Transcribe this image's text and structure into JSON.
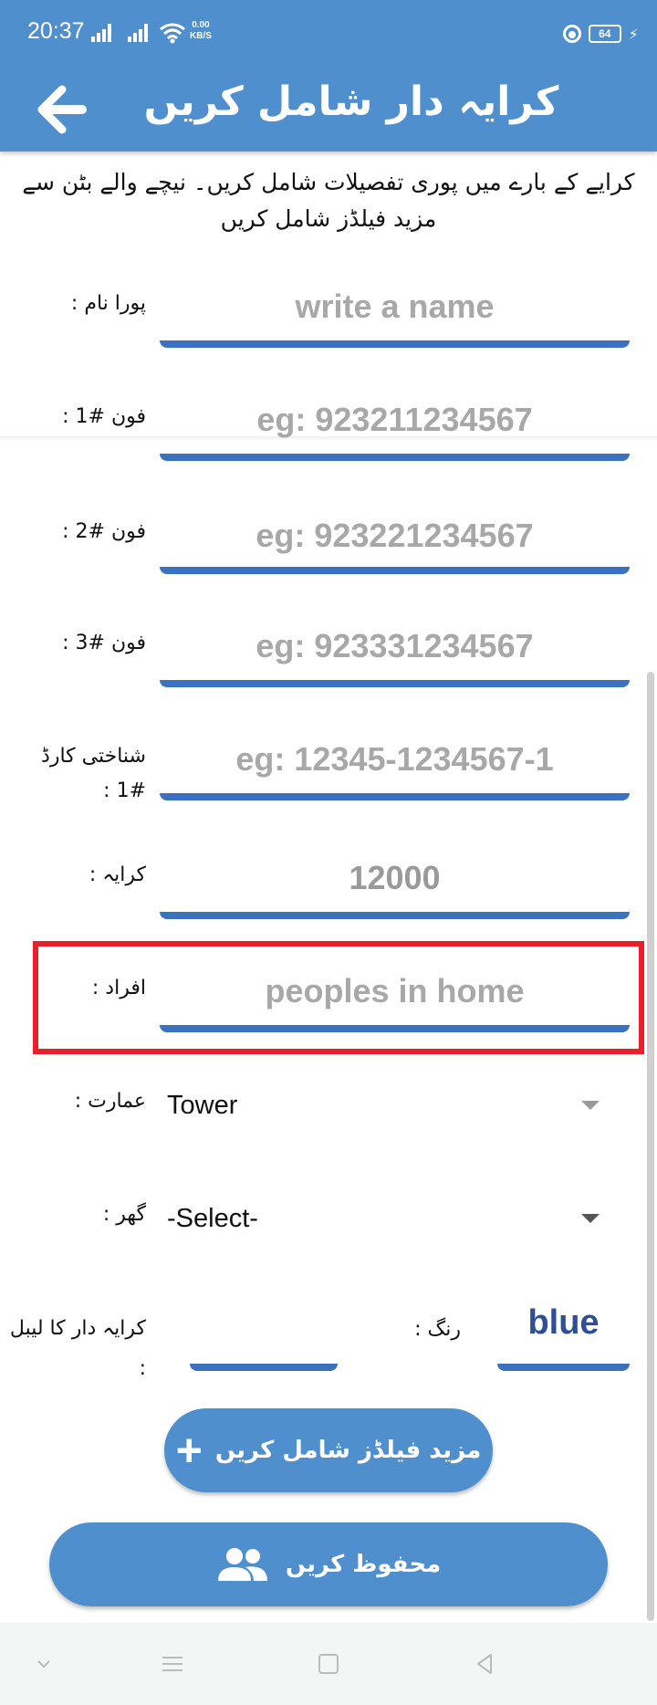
{
  "status_bar": {
    "time": "20:37",
    "net_speed_value": "0.00",
    "net_speed_unit": "KB/S",
    "battery": "64"
  },
  "app_bar": {
    "title": "کرایہ دار شامل کریں",
    "back_icon": "arrow-left-icon"
  },
  "intro_text": "کرایے کے بارے میں پوری تفصیلات شامل کریں۔ نیچے والے بٹن سے مزید فیلڈز شامل کریں",
  "fields": {
    "full_name": {
      "label": "پورا نام :",
      "placeholder": "write a name",
      "value": ""
    },
    "phone1": {
      "label": "فون #1 :",
      "placeholder": "eg: 923211234567",
      "value": ""
    },
    "phone2": {
      "label": "فون #2 :",
      "placeholder": "eg: 923221234567",
      "value": ""
    },
    "phone3": {
      "label": "فون #3 :",
      "placeholder": "eg: 923331234567",
      "value": ""
    },
    "cnic1": {
      "label": "شناختی کارڈ #1 :",
      "placeholder": "eg: 12345-1234567-1",
      "value": ""
    },
    "rent": {
      "label": "کرایہ :",
      "placeholder": "",
      "value": "12000"
    },
    "people": {
      "label": "افراد :",
      "placeholder": "peoples in home",
      "value": ""
    }
  },
  "selects": {
    "building": {
      "label": "عمارت :",
      "selected": "Tower"
    },
    "house": {
      "label": "گھر :",
      "selected": "-Select-"
    }
  },
  "tenant_label": {
    "label": "کرایہ دار کا لیبل :",
    "value": ""
  },
  "color": {
    "label": "رنگ :",
    "value": "blue"
  },
  "buttons": {
    "add_fields": "مزید فیلڈز شامل کریں",
    "add_fields_icon": "plus-icon",
    "save": "محفوظ کریں",
    "save_icon": "people-icon"
  },
  "colors": {
    "primary": "#4f8fcd",
    "underline": "#3b72bf",
    "highlight": "#e8202a",
    "color_value": "#2e4f95"
  }
}
